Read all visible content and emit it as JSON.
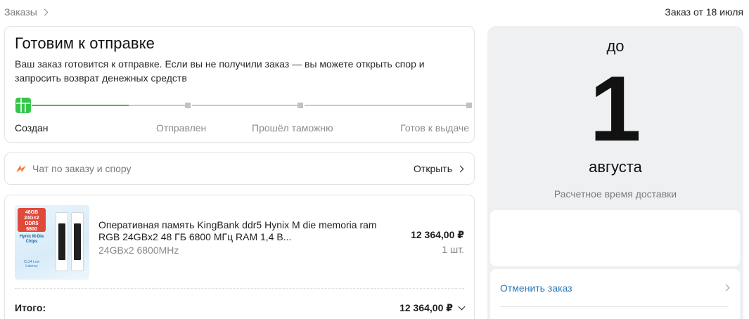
{
  "breadcrumb": {
    "label": "Заказы"
  },
  "order": {
    "date_label": "Заказ от 18 июля"
  },
  "status": {
    "title": "Готовим к отправке",
    "description": "Ваш заказ готовится к отправке. Если вы не получили заказ — вы можете открыть спор и запросить возврат денежных средств",
    "steps": [
      "Создан",
      "Отправлен",
      "Прошёл таможню",
      "Готов к выдаче"
    ],
    "progress_fraction": 0.25,
    "accent_color": "#36c54b"
  },
  "chat": {
    "label": "Чат по заказу и спору",
    "action": "Открыть",
    "icon": "chat-bolt-icon",
    "icon_color": "#f07a3a"
  },
  "product": {
    "title": "Оперативная память KingBank ddr5 Hynix M die memoria ram RGB 24GBx2 48 ГБ 6800 МГц RAM 1,4 В...",
    "variant": "24GBx2 6800MHz",
    "price": "12 364,00 ₽",
    "quantity": "1 шт.",
    "image_badge": "48GB 24G×2 DDR5 6800",
    "image_chip": "Hynix M-Die Chips",
    "image_tag": "CL34 Low Latency"
  },
  "total": {
    "label": "Итого:",
    "value": "12 364,00 ₽"
  },
  "delivery": {
    "prefix": "до",
    "day": "1",
    "month": "августа",
    "caption": "Расчетное время доставки",
    "cancel_label": "Отменить заказ",
    "link_color": "#2a7ab8"
  }
}
